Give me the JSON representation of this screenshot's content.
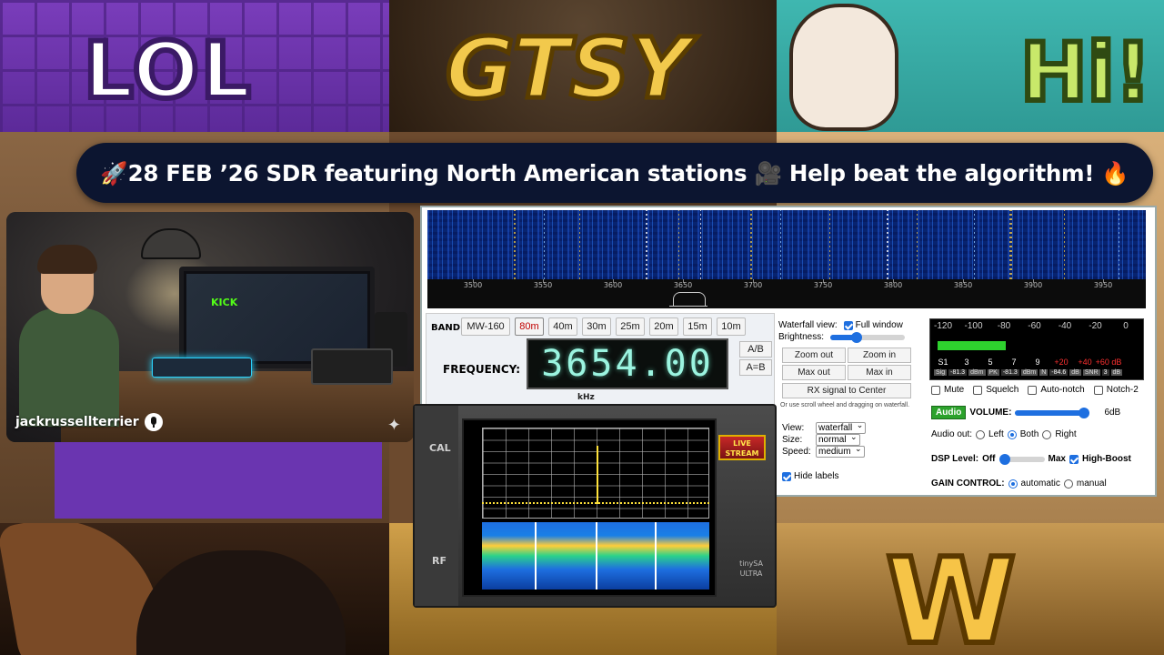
{
  "banner": {
    "title": "🚀28 FEB ’26 SDR featuring North American stations 🎥 Help beat the algorithm! 🔥"
  },
  "background": {
    "emote_lol": "LOL",
    "emote_gtsy": "GTSY",
    "emote_hi": "Hi!",
    "emote_w": "W"
  },
  "webcam": {
    "username": "jackrussellterrier",
    "monitor_text": "KICK"
  },
  "sdr": {
    "waterfall": {
      "scale_labels": [
        "3500",
        "3550",
        "3600",
        "3650",
        "3700",
        "3750",
        "3800",
        "3850",
        "3900",
        "3950"
      ]
    },
    "band": {
      "label": "BAND:",
      "buttons": [
        "MW-160",
        "80m",
        "40m",
        "30m",
        "25m",
        "20m",
        "15m",
        "10m"
      ],
      "active": "80m"
    },
    "frequency": {
      "label": "FREQUENCY:",
      "value": "3654.00",
      "unit": "kHz",
      "ab_label": "A/B",
      "a_eq_b_label": "A=B"
    },
    "waterfall_view": {
      "title": "Waterfall view:",
      "full_window_label": "Full window",
      "full_window_checked": true,
      "brightness_label": "Brightness:",
      "brightness_level": 0.35,
      "zoom_out": "Zoom out",
      "zoom_in": "Zoom in",
      "max_out": "Max out",
      "max_in": "Max in",
      "rx_center": "RX signal to Center",
      "hint": "Or use scroll wheel and dragging on waterfall.",
      "view_label": "View:",
      "view_value": "waterfall",
      "size_label": "Size:",
      "size_value": "normal",
      "speed_label": "Speed:",
      "speed_value": "medium",
      "hide_labels": "Hide labels",
      "hide_labels_checked": true
    },
    "smeter": {
      "top_scale": [
        "-120",
        "-100",
        "-80",
        "-60",
        "-40",
        "-20",
        "0"
      ],
      "bottom_scale": [
        "S1",
        "3",
        "5",
        "7",
        "9",
        "+20",
        "+40",
        "+60 dB"
      ],
      "level": 0.34,
      "sig_label": "Sig",
      "sig_value": "-81.3",
      "sig_unit": "dBm",
      "pk_label": "PK",
      "pk_value": "-81.3",
      "pk_unit": "dBm",
      "n_label": "N",
      "n_value": "-84.6",
      "n_unit": "dB",
      "snr_label": "SNR",
      "snr_value": "3",
      "snr_unit": "dB"
    },
    "controls": {
      "mute": "Mute",
      "squelch": "Squelch",
      "autonotch": "Auto-notch",
      "notch2": "Notch-2",
      "audio_btn": "Audio",
      "volume_label": "VOLUME:",
      "volume_value": "6dB",
      "volume_level": 0.95,
      "audio_out_label": "Audio out:",
      "left": "Left",
      "both": "Both",
      "right": "Right",
      "audio_out_selected": "Both",
      "dsp_label": "DSP Level:",
      "dsp_off": "Off",
      "dsp_max": "Max",
      "dsp_level": 0.0,
      "high_boost": "High-Boost",
      "high_boost_checked": true,
      "gain_label": "GAIN CONTROL:",
      "gain_auto": "automatic",
      "gain_manual": "manual",
      "gain_selected": "automatic"
    }
  },
  "tinysa": {
    "cal_label": "CAL",
    "rf_label": "RF",
    "live_stream": "LIVE STREAM",
    "brand": "tinySA ULTRA"
  }
}
